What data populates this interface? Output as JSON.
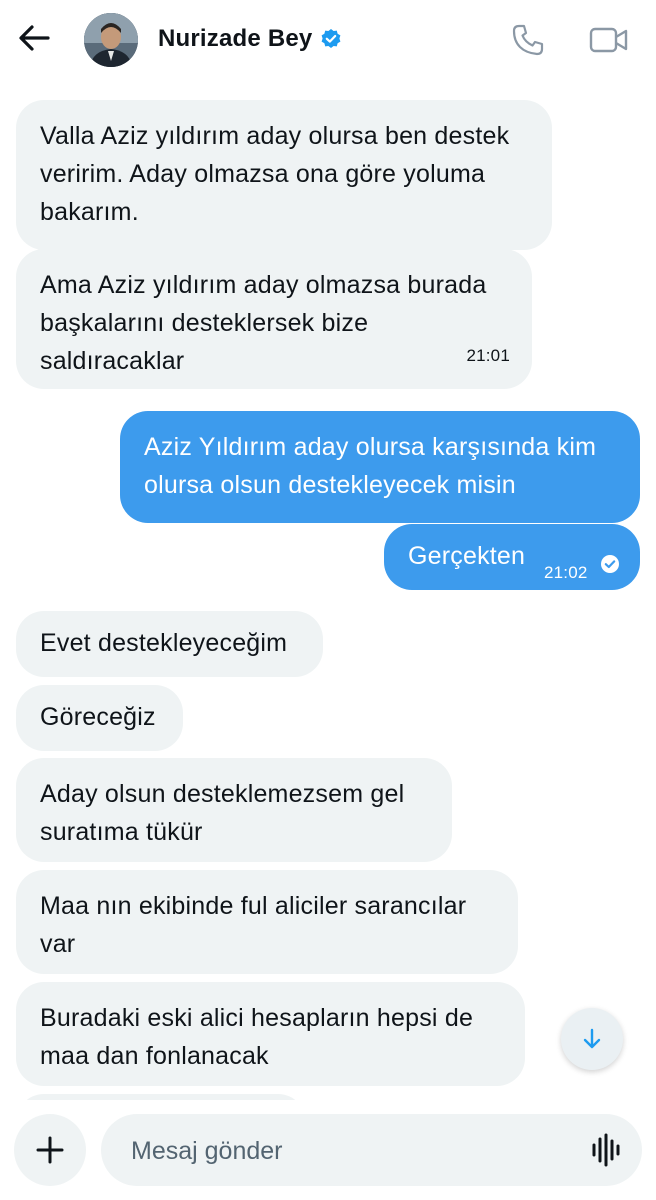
{
  "header": {
    "contact_name": "Nurizade Bey",
    "verified": true,
    "icons": [
      "back-arrow-icon",
      "verified-badge-icon",
      "phone-icon",
      "video-camera-icon"
    ]
  },
  "messages": [
    {
      "side": "in",
      "text": "Valla Aziz yıldırım aday olursa ben destek veririm. Aday olmazsa ona göre yoluma bakarım.",
      "time": ""
    },
    {
      "side": "in",
      "text": "Ama Aziz yıldırım aday olmazsa burada başkalarını desteklersek bize saldıracaklar",
      "time": "21:01"
    },
    {
      "side": "out",
      "text": "Aziz Yıldırım aday olursa karşısında kim olursa olsun destekleyecek misin",
      "time": ""
    },
    {
      "side": "out",
      "text": "Gerçekten",
      "time": "21:02",
      "read": true
    },
    {
      "side": "in",
      "text": "Evet destekleyeceğim",
      "time": ""
    },
    {
      "side": "in",
      "text": "Göreceğiz",
      "time": ""
    },
    {
      "side": "in",
      "text": "Aday olsun desteklemezsem gel suratıma tükür",
      "time": ""
    },
    {
      "side": "in",
      "text": "Maa nın ekibinde ful aliciler sarancılar var",
      "time": ""
    },
    {
      "side": "in",
      "text": "Buradaki eski alici hesapların hepsi de maa dan fonlanacak",
      "time": ""
    }
  ],
  "composer": {
    "placeholder": "Mesaj gönder",
    "icons": [
      "plus-icon",
      "voice-waveform-icon"
    ]
  },
  "scroll_button": {
    "icon": "arrow-down-icon"
  },
  "colors": {
    "outgoing_bubble": "#3d9bed",
    "incoming_bubble": "#eff3f4",
    "accent": "#1d9bf0"
  }
}
